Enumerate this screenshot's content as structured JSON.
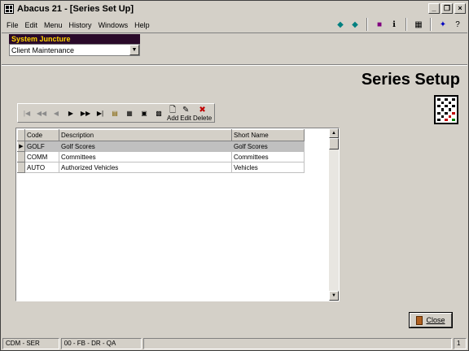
{
  "window": {
    "title": "Abacus 21 - [Series Set Up]"
  },
  "menu": [
    "File",
    "Edit",
    "Menu",
    "History",
    "Windows",
    "Help"
  ],
  "juncture": {
    "label": "System Juncture",
    "value": "Client Maintenance"
  },
  "heading": "Series Setup",
  "toolbar": {
    "add": "Add",
    "edit": "Edit",
    "delete": "Delete"
  },
  "grid": {
    "columns": [
      "Code",
      "Description",
      "Short Name"
    ],
    "rows": [
      {
        "code": "GOLF",
        "description": "Golf Scores",
        "short": "Golf Scores"
      },
      {
        "code": "COMM",
        "description": "Committees",
        "short": "Committees"
      },
      {
        "code": "AUTO",
        "description": "Authorized Vehicles",
        "short": "Vehicles"
      }
    ]
  },
  "close_label": "Close",
  "status": [
    "CDM - SER",
    "00 - FB - DR - QA",
    "",
    "1"
  ],
  "colors": {
    "juncture_bg": "#2a0a2a",
    "juncture_fg": "#ffd400",
    "selected_row": "#c0c0c0"
  }
}
